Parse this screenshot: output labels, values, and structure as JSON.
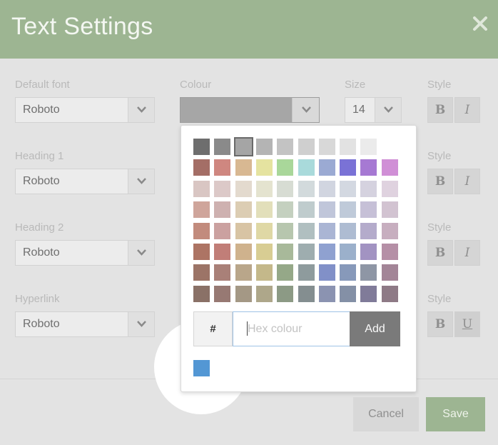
{
  "dialog": {
    "title": "Text Settings",
    "close_icon": "close-icon"
  },
  "columns": {
    "font": "Default font",
    "colour": "Colour",
    "size": "Size",
    "style": "Style"
  },
  "rows": [
    {
      "label": "Default font",
      "font": "Roboto",
      "colour": "#a6a6a6",
      "size": "14",
      "bold": "B",
      "italic": "I",
      "style_label": "Style"
    },
    {
      "label": "Heading 1",
      "font": "Roboto",
      "style_label": "Style",
      "bold": "B",
      "italic": "I"
    },
    {
      "label": "Heading 2",
      "font": "Roboto",
      "style_label": "Style",
      "bold": "B",
      "italic": "I"
    },
    {
      "label": "Hyperlink",
      "font": "Roboto",
      "style_label": "Style",
      "bold": "B",
      "underline": "U"
    }
  ],
  "colour_picker": {
    "palette": [
      [
        "#6e6e6e",
        "#8a8a8a",
        "#a5a5a5",
        "#b4b4b4",
        "#c3c3c3",
        "#cfcfcf",
        "#d8d8d8",
        "#e2e2e2",
        "#ebebeb",
        "#ffffff"
      ],
      [
        "#a46e66",
        "#cf8780",
        "#d8b892",
        "#e5e3a0",
        "#a9d79a",
        "#a9dadb",
        "#9baad3",
        "#7a72d6",
        "#a679d3",
        "#d08fd6"
      ],
      [
        "#d9c6c3",
        "#dcc9c8",
        "#e3dace",
        "#e4e3cf",
        "#d7dcd3",
        "#d2dadc",
        "#d1d5e0",
        "#d3d8e1",
        "#d5d2df",
        "#dfd2df"
      ],
      [
        "#cfa59b",
        "#ceb1b0",
        "#dccdb3",
        "#e2dfba",
        "#c4d0bf",
        "#bfcccd",
        "#c0c6da",
        "#bfcad9",
        "#c6c0d7",
        "#d2c3d1"
      ],
      [
        "#c28b7d",
        "#cba1a0",
        "#d8c4a4",
        "#dfd8a5",
        "#b7c6ae",
        "#b0bfc0",
        "#aab5d4",
        "#aebcd2",
        "#b4abcb",
        "#c7aebf"
      ],
      [
        "#ad7464",
        "#c17e78",
        "#cfb28d",
        "#d8cd93",
        "#a8b99a",
        "#9eadaf",
        "#8fa1d0",
        "#9bb0cb",
        "#a293c2",
        "#b58fa6"
      ],
      [
        "#9c7467",
        "#a98078",
        "#b9a68a",
        "#c4b88a",
        "#95a888",
        "#8e9b9d",
        "#8190c8",
        "#8799ba",
        "#8e96a5",
        "#a38597"
      ],
      [
        "#8a7167",
        "#977973",
        "#a49885",
        "#aea78a",
        "#8c9a85",
        "#848e90",
        "#8b93b1",
        "#8490a6",
        "#807b99",
        "#8e7a86"
      ]
    ],
    "hash_label": "#",
    "hex_placeholder": "Hex colour",
    "hex_value": "",
    "add_label": "Add",
    "recent_colours": [
      "#5397d4"
    ]
  },
  "footer": {
    "cancel_label": "Cancel",
    "save_label": "Save"
  },
  "colors": {
    "header_bg": "#9db592",
    "save_bg": "#9db592",
    "overlay_bg": "#e3e3e3",
    "add_bg": "#7a7a7a",
    "recent_swatch": "#5397d4"
  }
}
